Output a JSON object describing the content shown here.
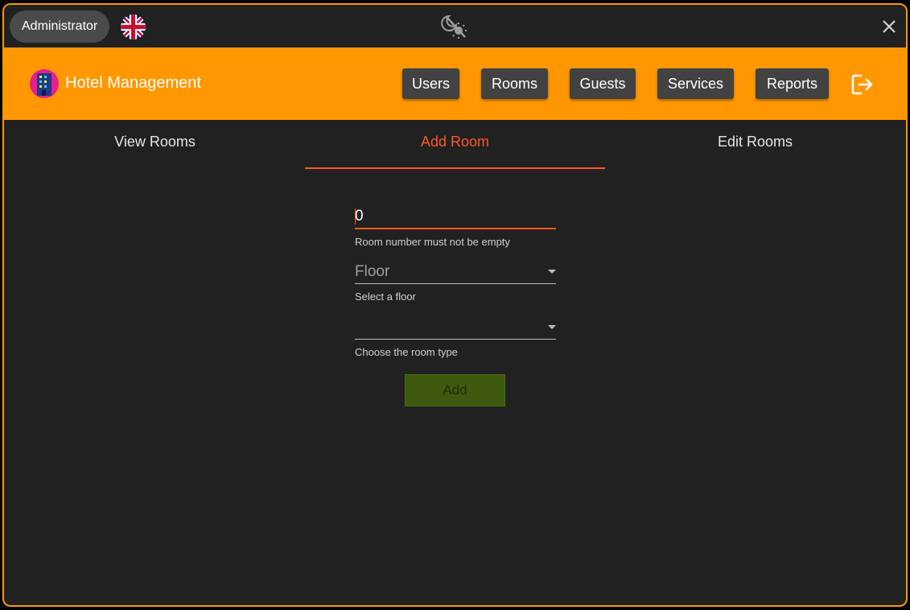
{
  "titlebar": {
    "role": "Administrator",
    "flag_icon": "uk-flag-icon",
    "theme_icon": "theme-toggle-icon",
    "close_icon": "close-icon"
  },
  "appbar": {
    "title": "Hotel Management",
    "logo_icon": "hotel-logo-icon",
    "nav": [
      "Users",
      "Rooms",
      "Guests",
      "Services",
      "Reports"
    ],
    "logout_icon": "logout-icon",
    "background": "#ff9800"
  },
  "tabs": {
    "items": [
      "View Rooms",
      "Add Room",
      "Edit Rooms"
    ],
    "active": "Add Room",
    "accent": "#ff5722"
  },
  "form": {
    "room_number": {
      "value": "0",
      "helper": "Room number must not be empty"
    },
    "floor": {
      "placeholder": "Floor",
      "helper": "Select a floor"
    },
    "room_type": {
      "value": "",
      "helper": "Choose the room type"
    },
    "submit_label": "Add"
  }
}
